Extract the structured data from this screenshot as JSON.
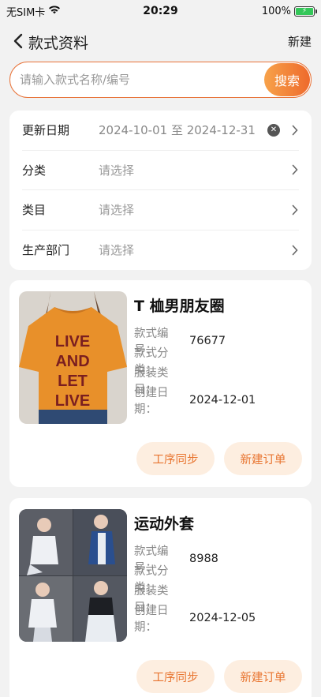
{
  "status_bar": {
    "carrier": "无SIM卡",
    "time": "20:29",
    "battery": "100%"
  },
  "nav": {
    "title": "款式资料",
    "new_label": "新建"
  },
  "search": {
    "placeholder": "请输入款式名称/编号",
    "button_label": "搜索"
  },
  "filters": [
    {
      "label": "更新日期",
      "value": "2024-10-01 至 2024-12-31"
    },
    {
      "label": "分类",
      "value": "请选择"
    },
    {
      "label": "类目",
      "value": "请选择"
    },
    {
      "label": "生产部门",
      "value": "请选择"
    }
  ],
  "meta_labels": {
    "code": "款式编号：",
    "category": "款式分类：",
    "clothing_type": "服装类目：",
    "created": "创建日期："
  },
  "styles": [
    {
      "title": "T 桖男朋友圈",
      "code": "76677",
      "category": "",
      "clothing_type": "",
      "created": "2024-12-01",
      "image_text": [
        "LIVE",
        "AND",
        "LET",
        "LIVE"
      ],
      "actions": [
        "工序同步",
        "新建订单"
      ]
    },
    {
      "title": "运动外套",
      "code": "8988",
      "category": "",
      "clothing_type": "",
      "created": "2024-12-05",
      "actions": [
        "工序同步",
        "新建订单"
      ]
    }
  ],
  "colors": {
    "accent": "#ee6a2c",
    "accent_light": "#fdeee0"
  }
}
